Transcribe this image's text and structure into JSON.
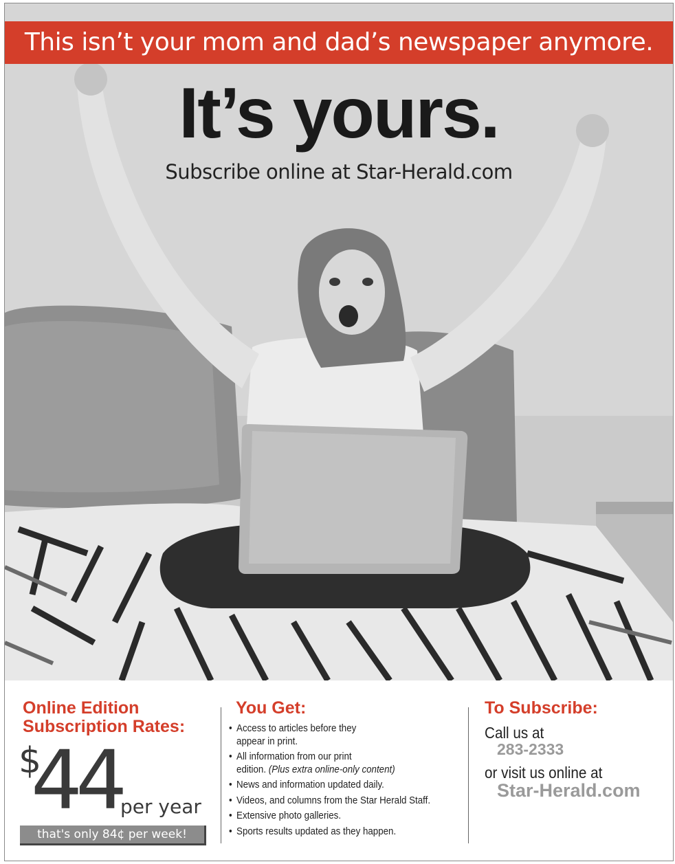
{
  "banner": {
    "tagline": "This isn’t your mom and dad’s newspaper anymore."
  },
  "hero": {
    "headline": "It’s yours.",
    "subline": "Subscribe online at Star-Herald.com"
  },
  "rates": {
    "title_line1": "Online Edition",
    "title_line2": "Subscription Rates:",
    "currency": "$",
    "price": "44",
    "period": "per year",
    "weekly": "that's only 84¢ per week!"
  },
  "you_get": {
    "title": "You Get:",
    "items": [
      {
        "line1": "Access to articles before they",
        "line2": "appear in print."
      },
      {
        "line1": "All information from our print",
        "line2": "edition.",
        "line2_italic": "(Plus extra online-only content)"
      },
      {
        "line1": "News and information updated daily."
      },
      {
        "line1": "Videos, and columns from the Star Herald Staff."
      },
      {
        "line1": "Extensive photo galleries."
      },
      {
        "line1": "Sports results updated as they happen."
      }
    ]
  },
  "subscribe": {
    "title": "To Subscribe:",
    "call_label": "Call us at",
    "phone": "283-2333",
    "visit_label": "or visit us online at",
    "site": "Star-Herald.com"
  },
  "colors": {
    "accent": "#d43e2a",
    "grey_text": "#9a9a9a"
  },
  "photo": {
    "subject": "photo-of-girl-celebrating-with-laptop-on-bed"
  }
}
